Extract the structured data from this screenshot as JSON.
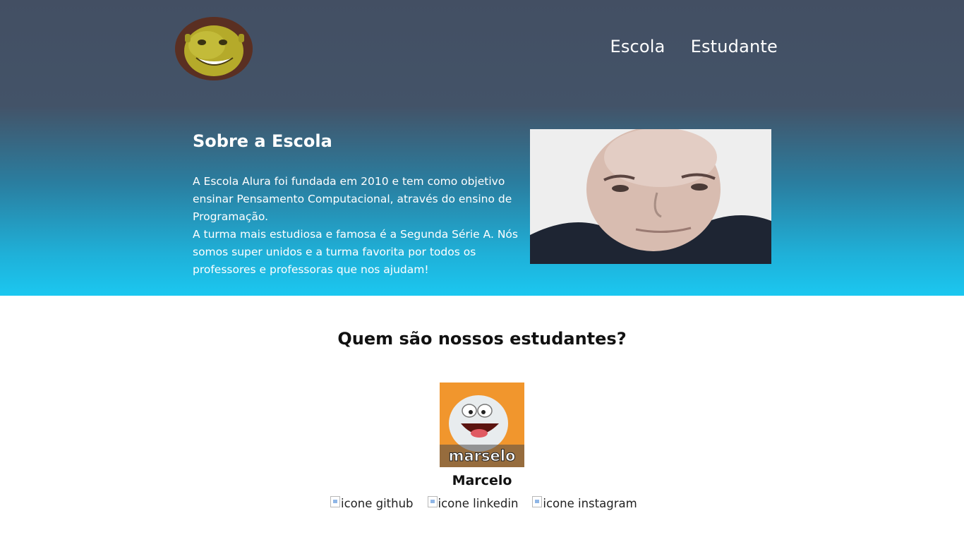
{
  "header": {
    "logo_alt": "shrek-logo",
    "nav": [
      {
        "label": "Escola"
      },
      {
        "label": "Estudante"
      }
    ]
  },
  "about": {
    "title": "Sobre a Escola",
    "text": "A Escola Alura foi fundada em 2010 e tem como objetivo ensinar Pensamento Computacional, através do ensino de Programação.\nA turma mais estudiosa e famosa é a Segunda Série A. Nós somos super unidos e a turma favorita por todos os professores e professoras que nos ajudam!"
  },
  "students": {
    "title": "Quem são nossos estudantes?",
    "items": [
      {
        "name": "Marcelo",
        "photo_caption": "marselo",
        "socials": [
          {
            "label": "icone github",
            "icon": "broken-image-icon"
          },
          {
            "label": "icone linkedin",
            "icon": "broken-image-icon"
          },
          {
            "label": "icone instagram",
            "icon": "broken-image-icon"
          }
        ]
      }
    ]
  },
  "colors": {
    "header_bg": "#434f63",
    "gradient_end": "#1bc7f0",
    "text_light": "#ffffff",
    "text_dark": "#111111"
  }
}
